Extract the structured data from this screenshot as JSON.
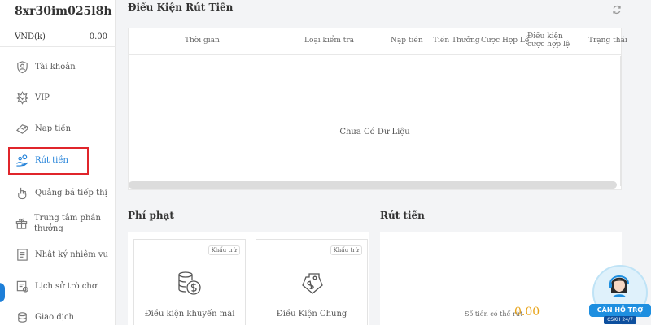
{
  "user": {
    "username": "8xr30im025l8h",
    "currency_label": "VND(k)",
    "balance": "0.00"
  },
  "sidebar": {
    "items": [
      {
        "label": "Tài khoản",
        "icon": "account-icon"
      },
      {
        "label": "VIP",
        "icon": "vip-icon"
      },
      {
        "label": "Nạp tiền",
        "icon": "deposit-icon"
      },
      {
        "label": "Rút tiền",
        "icon": "withdraw-icon"
      },
      {
        "label": "Quảng bá tiếp thị",
        "icon": "promote-icon"
      },
      {
        "label": "Trung tâm phần thưởng",
        "icon": "gift-icon"
      },
      {
        "label": "Nhật ký nhiệm vụ",
        "icon": "task-log-icon"
      },
      {
        "label": "Lịch sử trò chơi",
        "icon": "game-history-icon"
      },
      {
        "label": "Giao dịch",
        "icon": "transaction-icon"
      }
    ],
    "active_index": 3
  },
  "conditions": {
    "title": "Điều Kiện Rút Tiền",
    "columns": [
      "Thời gian",
      "Loại kiểm tra",
      "Nạp tiền",
      "Tiền Thưởng",
      "Cược Hợp Lệ",
      "Điều kiện cược hợp lệ",
      "Trạng thái"
    ],
    "empty_message": "Chưa Có Dữ Liệu"
  },
  "penalty": {
    "title": "Phí phạt",
    "cards": [
      {
        "badge": "Khấu trừ",
        "name": "Điều kiện khuyến mãi",
        "icon": "coins-icon"
      },
      {
        "badge": "Khấu trừ",
        "name": "Điều Kiện Chung",
        "icon": "tag-icon"
      }
    ]
  },
  "withdraw": {
    "title": "Rút tiền",
    "amount_label": "Số tiền có thể rút",
    "amount": "0.00"
  },
  "support": {
    "banner": "CẦN HỖ TRỢ",
    "sub": "CSKH 24/7"
  },
  "colors": {
    "accent": "#1e7fd8",
    "highlight": "#e0252b",
    "amount": "#e8a317"
  }
}
